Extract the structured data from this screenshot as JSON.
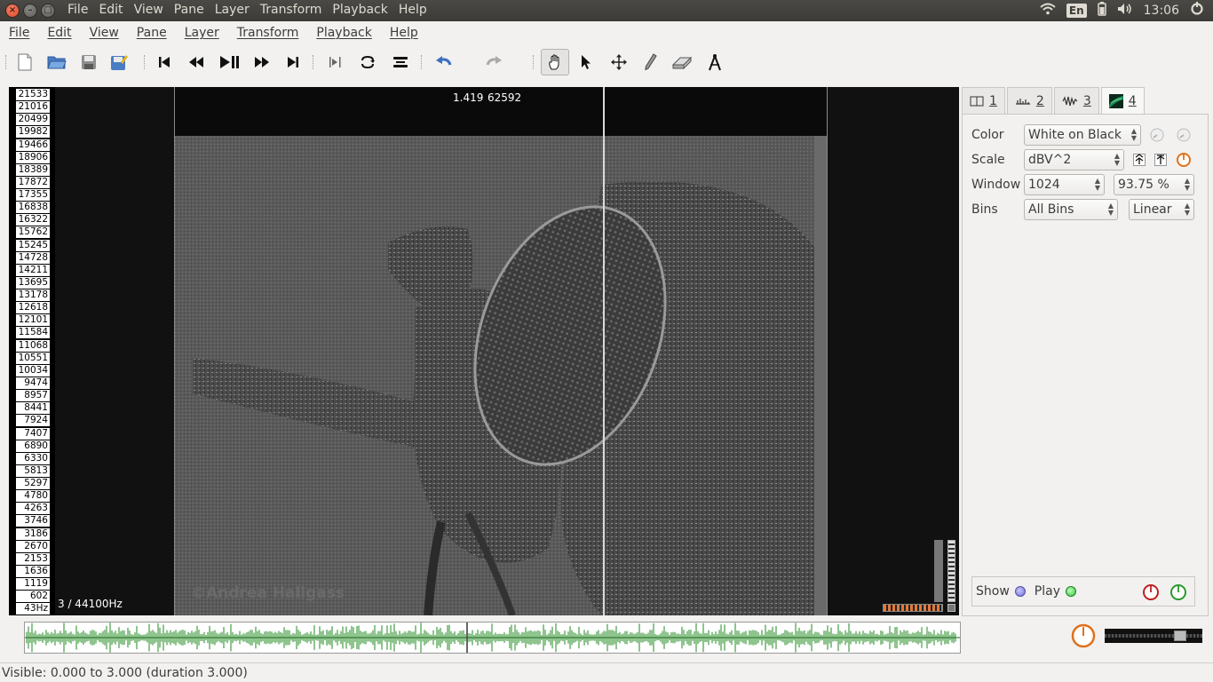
{
  "topbar": {
    "menus": [
      "File",
      "Edit",
      "View",
      "Pane",
      "Layer",
      "Transform",
      "Playback",
      "Help"
    ],
    "keyboard_layout": "En",
    "clock": "13:06"
  },
  "menubar": [
    "File",
    "Edit",
    "View",
    "Pane",
    "Layer",
    "Transform",
    "Playback",
    "Help"
  ],
  "toolbar": {
    "icons": [
      "new-file-icon",
      "open-folder-icon",
      "save-icon",
      "save-as-icon",
      "rewind-start-icon",
      "rewind-icon",
      "play-pause-icon",
      "fast-forward-icon",
      "fast-forward-end-icon",
      "constrain-to-selection-icon",
      "loop-icon",
      "solo-icon",
      "undo-icon",
      "redo-icon",
      "navigate-hand-icon",
      "select-arrow-icon",
      "move-icon",
      "draw-pencil-icon",
      "erase-icon",
      "measure-icon"
    ]
  },
  "frequency_scale": [
    "21533",
    "21016",
    "20499",
    "19982",
    "19466",
    "18906",
    "18389",
    "17872",
    "17355",
    "16838",
    "16322",
    "15762",
    "15245",
    "14728",
    "14211",
    "13695",
    "13178",
    "12618",
    "12101",
    "11584",
    "11068",
    "10551",
    "10034",
    "9474",
    "8957",
    "8441",
    "7924",
    "7407",
    "6890",
    "6330",
    "5813",
    "5297",
    "4780",
    "4263",
    "3746",
    "3186",
    "2670",
    "2153",
    "1636",
    "1119",
    "602",
    "43Hz"
  ],
  "pane": {
    "playhead_time": "1.419",
    "playhead_frame": "62592",
    "rate_label": "3 / 44100Hz",
    "watermark": "©Andrea Hallgass"
  },
  "layer_tabs": [
    {
      "icon": "time-ruler-icon",
      "label": "1"
    },
    {
      "icon": "waveform-icon",
      "label": "2"
    },
    {
      "icon": "waveform-alt-icon",
      "label": "3"
    },
    {
      "icon": "spectrogram-icon",
      "label": "4"
    }
  ],
  "properties": {
    "color_label": "Color",
    "color_value": "White on Black",
    "scale_label": "Scale",
    "scale_value": "dBV^2",
    "window_label": "Window",
    "window_size": "1024",
    "window_overlap": "93.75 %",
    "bins_label": "Bins",
    "bins_value": "All Bins",
    "bins_scale": "Linear",
    "show_label": "Show",
    "play_label": "Play"
  },
  "statusbar": {
    "text": "Visible: 0.000 to 3.000 (duration 3.000)"
  },
  "colors": {
    "waveform": "#1f8a1f",
    "close_button": "#e0461f",
    "show_dot": "#6d6dd8",
    "play_dot": "#3cc43c"
  }
}
